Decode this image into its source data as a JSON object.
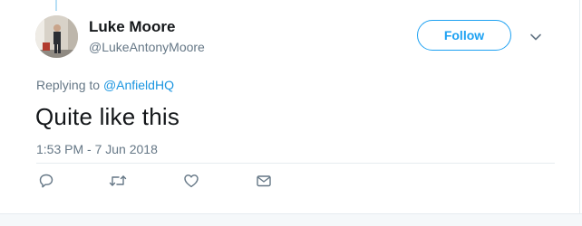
{
  "tweet": {
    "author": {
      "name": "Luke Moore",
      "handle": "@LukeAntonyMoore"
    },
    "follow_label": "Follow",
    "replying_prefix": "Replying to",
    "replying_to": "@AnfieldHQ",
    "text": "Quite like this",
    "timestamp": "1:53 PM - 7 Jun 2018"
  },
  "icons": {
    "menu": "chevron-down-icon",
    "reply": "reply-icon",
    "retweet": "retweet-icon",
    "like": "heart-icon",
    "dm": "envelope-icon"
  },
  "colors": {
    "accent": "#1da1f2",
    "link": "#1b95e0",
    "muted": "#657786",
    "text": "#14171a"
  }
}
